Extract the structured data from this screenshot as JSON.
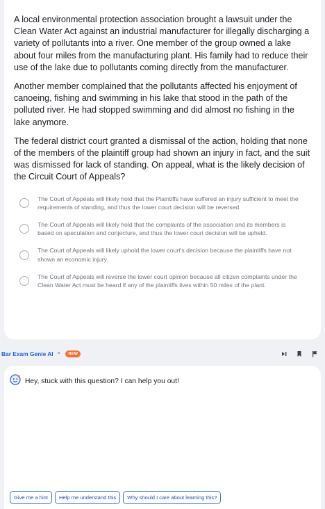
{
  "question": {
    "paragraphs": [
      "A local environmental protection association brought a lawsuit under the Clean Water Act against an industrial manufacturer for illegally discharging a variety of pollutants into a river. One member of the group owned a lake about four miles from the manufacturing plant. His family had to reduce their use of the lake due to pollutants coming directly from the manufacturer.",
      "Another member complained that the pollutants affected his enjoyment of canoeing, fishing and swimming in his lake that stood in the path of the polluted river. He had stopped swimming and did almost no fishing in the lake anymore.",
      "The federal district court granted a dismissal of the action, holding that none of the members of the plaintiff group had shown an injury in fact, and the suit was dismissed for lack of standing. On appeal, what is the likely decision of the Circuit Court of Appeals?"
    ],
    "options": [
      "The Court of Appeals will likely hold that the Plaintiffs have suffered an injury sufficient to meet the requirements of standing, and thus the lower court decision will be reversed.",
      "The Court of Appeals will likely hold that the complaints of the association and its members is based on speculation and conjecture, and thus the lower court decision will be upheld.",
      "The Court of Appeals will likely uphold the lower court's decision because the plaintiffs have not shown an economic injury.",
      "The Court of Appeals will reverse the lower court opinion because all citizen complaints under the Clean Water Act must be heard if any of the plaintiffs lives within 50 miles of the plant."
    ]
  },
  "ai_assistant": {
    "title": "Bar Exam Genie AI",
    "caret": "^",
    "badge": "NEW",
    "greeting": "Hey, stuck with this question? I can help you out!",
    "chips": [
      "Give me a hint",
      "Help me understand this",
      "Why should I care about learning this?"
    ]
  },
  "colors": {
    "accent": "#1f5fd0",
    "badge": "#f0743a",
    "background": "#f0f1f4"
  },
  "icons": {
    "toolbar": [
      "skip-icon",
      "bookmark-icon",
      "flag-icon"
    ],
    "bot": "bot-face-icon"
  }
}
